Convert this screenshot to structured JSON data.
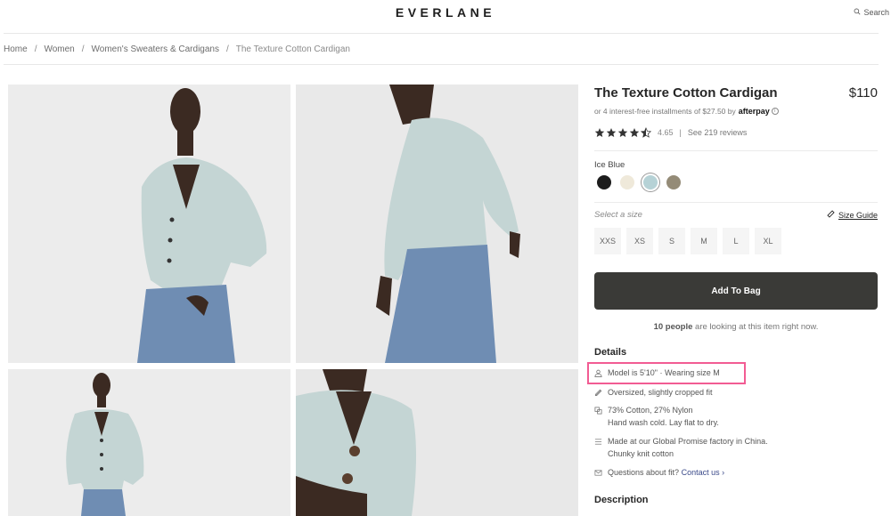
{
  "header": {
    "logo": "EVERLANE",
    "search_label": "Search"
  },
  "breadcrumb": [
    {
      "label": "Home"
    },
    {
      "label": "Women"
    },
    {
      "label": "Women's Sweaters & Cardigans"
    },
    {
      "label": "The Texture Cotton Cardigan"
    }
  ],
  "breadcrumb_separator": "/",
  "gallery": [
    {
      "alt": "Model front view wearing cardigan with jeans"
    },
    {
      "alt": "Model back view wearing cardigan"
    },
    {
      "alt": "Model full body front view"
    },
    {
      "alt": "Close-up of cardigan buttons"
    }
  ],
  "product": {
    "title": "The Texture Cotton Cardigan",
    "price": "$110",
    "afterpay_text": "or 4 interest-free installments of $27.50 by",
    "afterpay_brand": "afterpay",
    "rating_value": 4.65,
    "rating_text": "4.65",
    "reviews_link": "See 219 reviews",
    "color_label": "Ice Blue",
    "colors": [
      {
        "name": "Black",
        "hex": "#1c1c1c",
        "selected": false
      },
      {
        "name": "Cream",
        "hex": "#efe9da",
        "selected": false
      },
      {
        "name": "Ice Blue",
        "hex": "#b6d2d6",
        "selected": true
      },
      {
        "name": "Taupe",
        "hex": "#948b77",
        "selected": false
      }
    ],
    "size_label": "Select a size",
    "size_guide": "Size Guide",
    "sizes": [
      "XXS",
      "XS",
      "S",
      "M",
      "L",
      "XL"
    ],
    "add_to_bag": "Add To Bag",
    "watching_count": "10 people",
    "watching_text": "are looking at this item right now.",
    "details_heading": "Details",
    "details": {
      "model": "Model is 5'10\"  ·  Wearing size M",
      "fit": "Oversized, slightly cropped fit",
      "material": "73% Cotton, 27% Nylon",
      "care": "Hand wash cold. Lay flat to dry.",
      "factory": "Made at our Global Promise factory in China.",
      "knit": "Chunky knit cotton",
      "questions": "Questions about fit?",
      "contact": "Contact us ›"
    },
    "description_heading": "Description"
  },
  "colors": {
    "highlight": "#f25c93",
    "button_bg": "#3a3a37",
    "link": "#3b4a8a"
  }
}
